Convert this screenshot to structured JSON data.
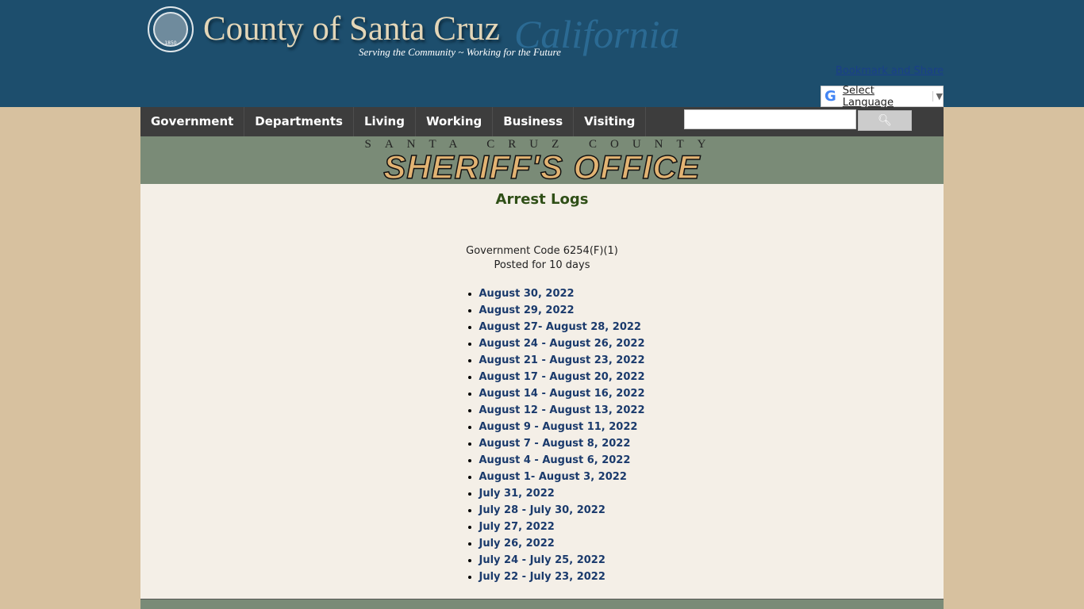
{
  "header": {
    "seal_year": "1850",
    "county": "County of Santa Cruz",
    "state": "California",
    "tagline": "Serving the Community ~ Working for the Future",
    "bookmark": "Bookmark and Share",
    "language": "Select Language"
  },
  "nav": [
    "Government",
    "Departments",
    "Living",
    "Working",
    "Business",
    "Visiting"
  ],
  "search": {
    "value": "",
    "button_icon": "search-icon"
  },
  "banner": {
    "line1": "SANTA CRUZ COUNTY",
    "line2": "SHERIFF'S OFFICE"
  },
  "main": {
    "title": "Arrest Logs",
    "code": "Government Code 6254(F)(1)",
    "posted": "Posted for 10 days",
    "links": [
      "August 30, 2022",
      "August 29, 2022",
      "August 27- August 28, 2022",
      "August 24 - August 26, 2022",
      "August 21 - August 23, 2022",
      "August 17 - August 20, 2022",
      "August 14 - August 16, 2022",
      "August 12 - August 13, 2022",
      "August 9 - August 11, 2022",
      "August 7 - August 8, 2022",
      "August 4 - August 6, 2022",
      "August 1- August 3, 2022",
      "July 31, 2022",
      "July 28 - July 30, 2022",
      "July 27, 2022",
      "July 26, 2022",
      "July 24 - July 25, 2022",
      "July 22 - July 23, 2022"
    ]
  }
}
